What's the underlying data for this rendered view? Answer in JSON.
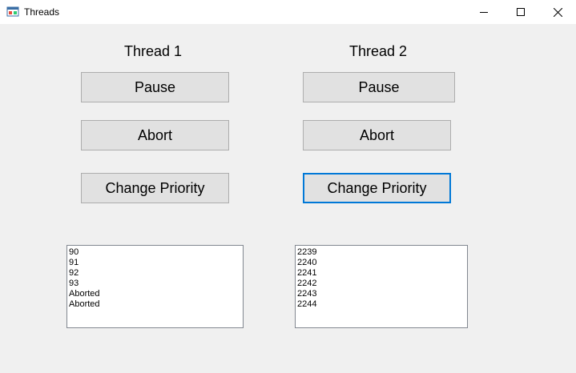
{
  "window": {
    "title": "Threads",
    "icon": "winforms-app-icon"
  },
  "thread1": {
    "heading": "Thread 1",
    "pause_label": "Pause",
    "abort_label": "Abort",
    "priority_label": "Change Priority",
    "list": [
      "90",
      "91",
      "92",
      "93",
      "Aborted",
      "Aborted"
    ]
  },
  "thread2": {
    "heading": "Thread 2",
    "pause_label": "Pause",
    "abort_label": "Abort",
    "priority_label": "Change Priority",
    "list": [
      "2239",
      "2240",
      "2241",
      "2242",
      "2243",
      "2244"
    ]
  },
  "colors": {
    "focus_border": "#0078d7",
    "button_bg": "#e1e1e1",
    "window_bg": "#f0f0f0"
  }
}
